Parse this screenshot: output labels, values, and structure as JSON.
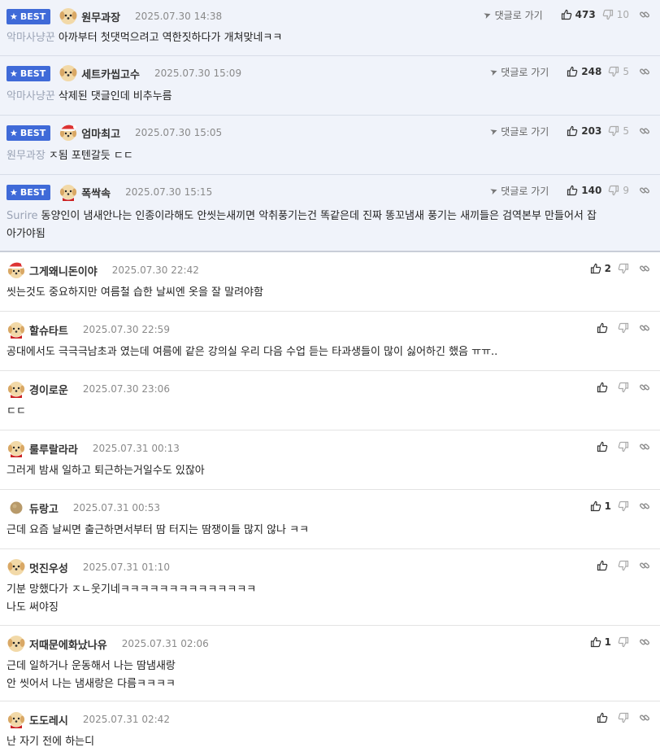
{
  "ui": {
    "goto_label": "댓글로 가기",
    "best_label": "BEST"
  },
  "best_comments": [
    {
      "nick": "원무과장",
      "time": "2025.07.30 14:38",
      "up": "473",
      "down": "10",
      "ref": "악마사냥꾼",
      "text": "아까부터 첫댓먹으려고 역한짓하다가 개쳐맞네ㅋㅋ"
    },
    {
      "nick": "세트카씹고수",
      "time": "2025.07.30 15:09",
      "up": "248",
      "down": "5",
      "ref": "악마사냥꾼",
      "text": "삭제된 댓글인데 비추누름"
    },
    {
      "nick": "엄마최고",
      "time": "2025.07.30 15:05",
      "up": "203",
      "down": "5",
      "ref": "원무과장",
      "text": "ㅈ됨 포텐갈듯 ㄷㄷ"
    },
    {
      "nick": "폭싹속",
      "time": "2025.07.30 15:15",
      "up": "140",
      "down": "9",
      "ref": "Surire",
      "text_line1": "동양인이 냄새안나는 인종이라해도 안씻는새끼면 악취풍기는건 똑같은데 진짜 똥꼬냄새 풍기는 새끼들은 검역본부 만들어서 잡",
      "text_line2": "아가야됨"
    }
  ],
  "comments": [
    {
      "nick": "그게왜니돈이야",
      "time": "2025.07.30 22:42",
      "up": "2",
      "text": "씻는것도 중요하지만 여름철 습한 날씨엔 옷을 잘 말려야함"
    },
    {
      "nick": "할슈타트",
      "time": "2025.07.30 22:59",
      "up": "",
      "text": "공대에서도 극극극남초과 였는데 여름에 같은 강의실 우리 다음 수업 듣는 타과생들이 많이 싫어하긴 했음 ㅠㅠ.."
    },
    {
      "nick": "경이로운",
      "time": "2025.07.30 23:06",
      "up": "",
      "text": "ㄷㄷ"
    },
    {
      "nick": "룰루랄라라",
      "time": "2025.07.31 00:13",
      "up": "",
      "text": "그러게 밤새 일하고 퇴근하는거일수도 있잖아"
    },
    {
      "nick": "듀랑고",
      "time": "2025.07.31 00:53",
      "up": "1",
      "text": "근데 요즘 날씨면 출근하면서부터 땀 터지는 땀쟁이들 많지 않나 ㅋㅋ"
    },
    {
      "nick": "멋진우성",
      "time": "2025.07.31 01:10",
      "up": "",
      "text_line1": "기분 망했다가 ㅈㄴ웃기네ㅋㅋㅋㅋㅋㅋㅋㅋㅋㅋㅋㅋㅋㅋ",
      "text_line2": "나도 써야징"
    },
    {
      "nick": "저때문에화났나유",
      "time": "2025.07.31 02:06",
      "up": "1",
      "text_line1": "근데 일하거나 운동해서 나는 땀냄새랑",
      "text_line2": "안 씻어서 나는 냄새랑은 다름ㅋㅋㅋㅋ"
    },
    {
      "nick": "도도레시",
      "time": "2025.07.31 02:42",
      "up": "",
      "text": "난 자기 전에 하는디"
    }
  ]
}
